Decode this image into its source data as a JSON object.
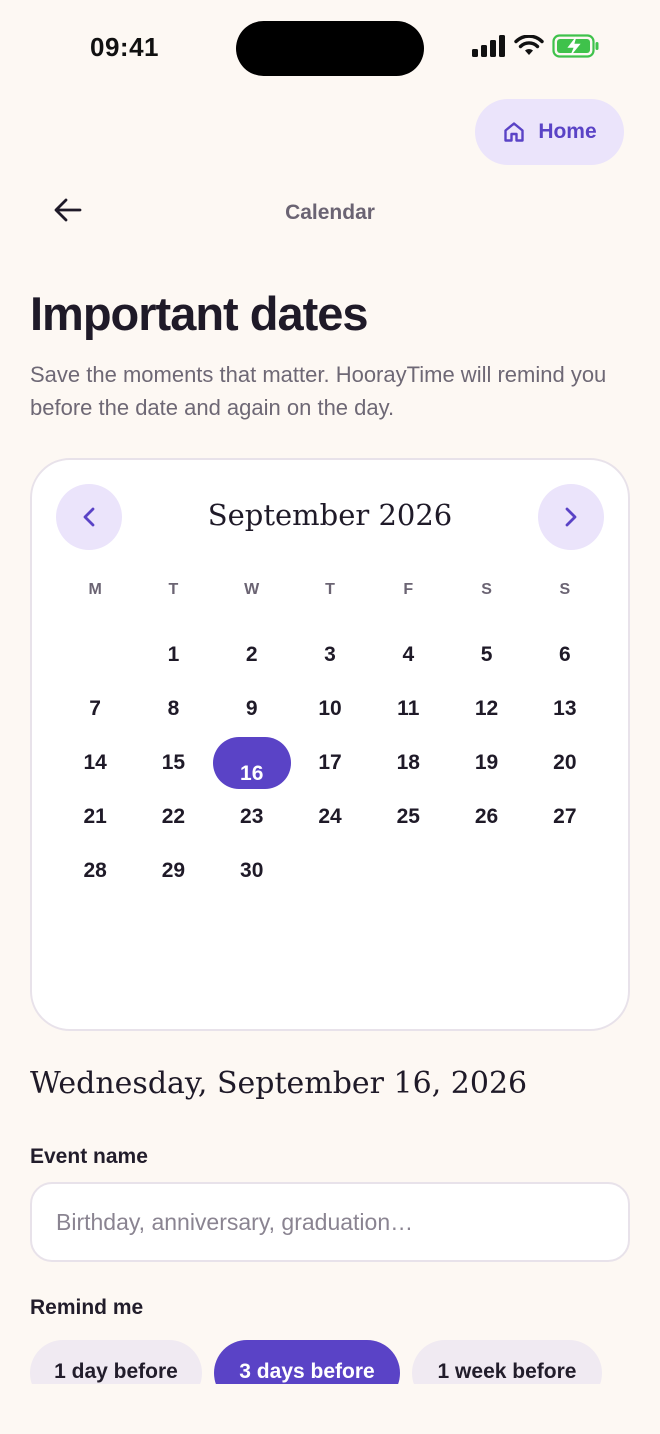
{
  "status_bar": {
    "time": "09:41",
    "icons": [
      "signal-bars-icon",
      "wifi-icon",
      "battery-charging-icon"
    ]
  },
  "header": {
    "home_label": "Home",
    "home_icon": "house-icon",
    "back_icon": "arrow-left-icon",
    "nav_title": "Calendar"
  },
  "page": {
    "title": "Important dates",
    "subtitle": "Save the moments that matter. HoorayTime will remind you before the date and again on the day."
  },
  "calendar": {
    "month_label": "September 2026",
    "weekdays": [
      "M",
      "T",
      "W",
      "T",
      "F",
      "S",
      "S"
    ],
    "leading_blanks": 1,
    "days": [
      "1",
      "2",
      "3",
      "4",
      "5",
      "6",
      "7",
      "8",
      "9",
      "10",
      "11",
      "12",
      "13",
      "14",
      "15",
      "16",
      "17",
      "18",
      "19",
      "20",
      "21",
      "22",
      "23",
      "24",
      "25",
      "26",
      "27",
      "28",
      "29",
      "30"
    ],
    "selected_day": "16"
  },
  "selection": {
    "date_heading": "Wednesday, September 16, 2026"
  },
  "form": {
    "event_name_label": "Event name",
    "event_name_value": "",
    "event_name_placeholder": "Birthday, anniversary, graduation…",
    "remind_label": "Remind me",
    "remind_options": [
      "1 day before",
      "3 days before",
      "1 week before"
    ],
    "remind_selected": "3 days before"
  },
  "colors": {
    "accent": "#5a43c6",
    "accent_soft": "#ebe4fb",
    "background": "#fdf8f3",
    "battery": "#3fc24b"
  }
}
